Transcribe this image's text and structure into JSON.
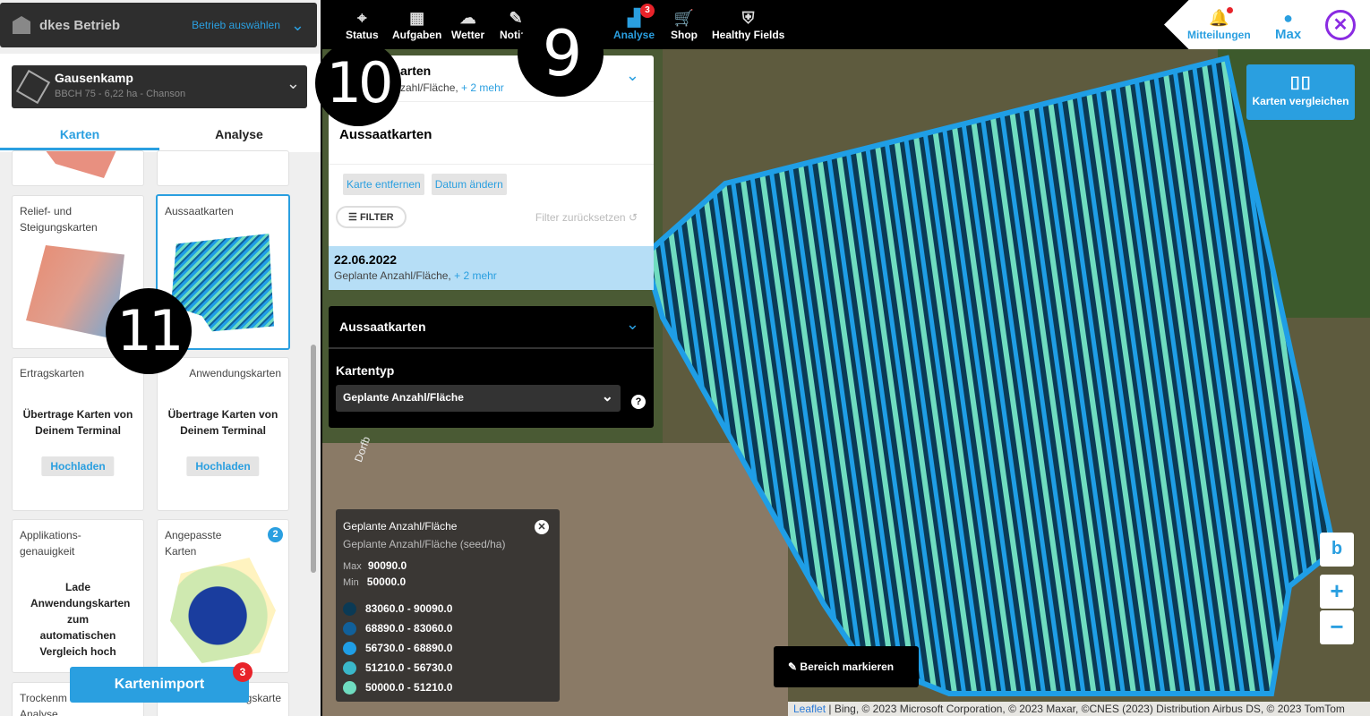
{
  "betrieb": {
    "name": "dkes Betrieb",
    "select_label": "Betrieb auswählen"
  },
  "field": {
    "name": "Gausenkamp",
    "subtitle": "BBCH 75 - 6,22 ha - Chanson"
  },
  "tabs": [
    "Karten",
    "Analyse"
  ],
  "cards": {
    "relief": "Relief- und Steigungskarten",
    "aussaat": "Aussaatkarten",
    "ertrag": "Ertragskarten",
    "anwendung": "Anwendungskarten",
    "upload_text": "Übertrage Karten von Deinem Terminal",
    "upload_btn": "Hochladen",
    "applikation": "Applikations-genauigkeit",
    "applikation_text": "Lade Anwendungskarten zum automatischen Vergleich hoch",
    "angepasst": "Angepasste Karten",
    "angepasst_badge": "2",
    "trocken": "Trockenm",
    "trocken2": "Analyse",
    "gskarte": "gskarte"
  },
  "kartenimport": {
    "label": "Kartenimport",
    "badge": "3"
  },
  "callouts": {
    "n9": "9",
    "n10": "10",
    "n11": "11"
  },
  "nav": [
    {
      "label": "Status",
      "icon": "⌖"
    },
    {
      "label": "Aufgaben",
      "icon": "▦"
    },
    {
      "label": "Wetter",
      "icon": "☁"
    },
    {
      "label": "Notizen",
      "icon": "✎"
    },
    {
      "label": "Analyse",
      "icon": "▟",
      "badge": "3"
    },
    {
      "label": "Shop",
      "icon": "🛒"
    },
    {
      "label": "Healthy Fields",
      "icon": "⛨"
    }
  ],
  "right": {
    "mitteilungen": "Mitteilungen",
    "user": "Max"
  },
  "panel": {
    "head_title": "arten",
    "head_sub": "zahl/Fläche,",
    "head_more": "+ 2 mehr",
    "section_title": "Aussaatkarten",
    "btn_remove": "Karte entfernen",
    "btn_date": "Datum ändern",
    "filter": "FILTER",
    "filter_reset": "Filter zurücksetzen",
    "date": "22.06.2022",
    "date_sub": "Geplante Anzahl/Fläche,",
    "date_more": "+ 2 mehr"
  },
  "dark": {
    "title": "Aussaatkarten",
    "kartentyp": "Kartentyp",
    "select": "Geplante Anzahl/Fläche"
  },
  "legend": {
    "title": "Geplante Anzahl/Fläche",
    "subtitle": "Geplante Anzahl/Fläche (seed/ha)",
    "max_label": "Max",
    "max": "90090.0",
    "min_label": "Min",
    "min": "50000.0",
    "ranges": [
      {
        "label": "83060.0 - 90090.0",
        "color": "#0b3a55"
      },
      {
        "label": "68890.0 - 83060.0",
        "color": "#11609a"
      },
      {
        "label": "56730.0 - 68890.0",
        "color": "#1f9ee6"
      },
      {
        "label": "51210.0 - 56730.0",
        "color": "#3ab7c9"
      },
      {
        "label": "50000.0 - 51210.0",
        "color": "#6fdcc0"
      }
    ]
  },
  "map": {
    "road_label": "Dorfb",
    "bereich": "Bereich markieren",
    "karten_vergleichen": "Karten vergleichen"
  },
  "attribution": {
    "leaflet": "Leaflet",
    "rest": " | Bing, © 2023 Microsoft Corporation, © 2023 Maxar, ©CNES (2023) Distribution Airbus DS, © 2023 TomTom"
  }
}
